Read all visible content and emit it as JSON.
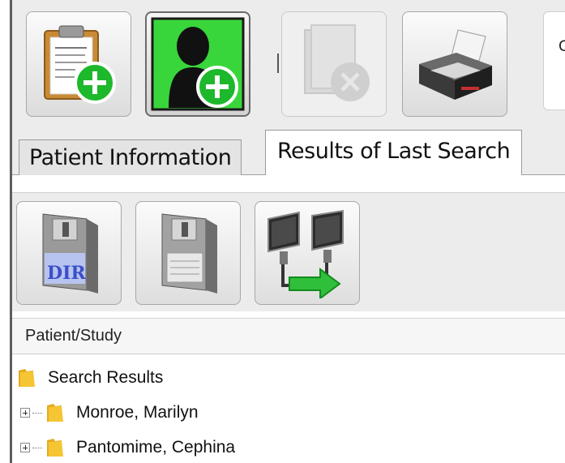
{
  "toolbar": {
    "new_patient_icon": "clipboard-add-icon",
    "new_person_icon": "person-add-icon",
    "delete_icon": "delete-study-icon",
    "print_icon": "printer-icon",
    "combo_text": "Cu"
  },
  "tabs": [
    {
      "label": "Patient Information",
      "active": false
    },
    {
      "label": "Results of Last Search",
      "active": true
    }
  ],
  "results_toolbar": {
    "save_dir_icon": "floppy-dir-icon",
    "save_icon": "floppy-disk-icon",
    "transfer_icon": "computer-transfer-icon"
  },
  "tree": {
    "header": "Patient/Study",
    "root": "Search Results",
    "items": [
      {
        "label": "Monroe, Marilyn"
      },
      {
        "label": "Pantomime, Cephina"
      }
    ]
  },
  "colors": {
    "accent_green": "#1db82b",
    "folder_yellow": "#f5c534",
    "toolbar_bg": "#ececec"
  }
}
